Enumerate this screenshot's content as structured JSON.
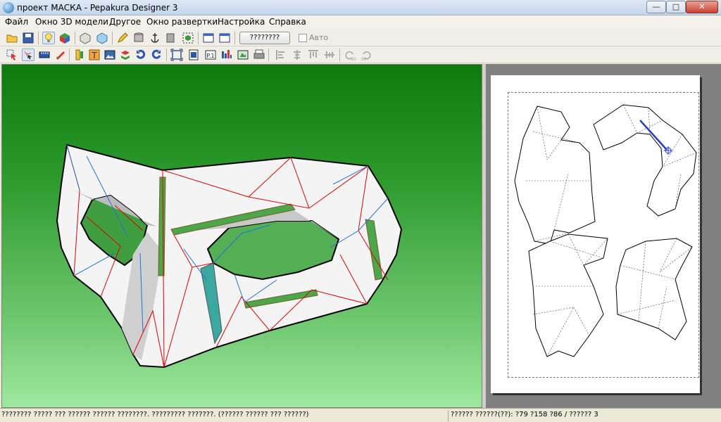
{
  "window": {
    "title": "проект МАСКА - Pepakura Designer 3",
    "min_label": "—",
    "max_label": "□",
    "close_label": "✕"
  },
  "menu": {
    "items": [
      "Файл",
      "Окно 3D модели",
      "Другое",
      "Окно развертки",
      "Настройка",
      "Справка"
    ]
  },
  "toolbar": {
    "unfold_button_label": "????????",
    "auto_label": "Авто",
    "auto_checked": false
  },
  "icons": {
    "toolbar1": [
      "open-folder-icon",
      "save-icon",
      "light-bulb-icon",
      "color-cube-icon",
      "wire-cube-icon",
      "texture-cube-icon",
      "pencil-icon",
      "cylinder-icon",
      "anchor-icon",
      "box-icon",
      "cube-select-icon",
      "single-view-icon",
      "split-view-icon"
    ],
    "toolbar2": [
      "select-arrow-icon",
      "edge-select-icon",
      "edge-ruler-icon",
      "brush-icon",
      "flap-icon",
      "text-icon",
      "image-icon",
      "join-icon",
      "rotate-icon",
      "undo-rotate-icon",
      "fit-frame-icon",
      "page-frame-icon",
      "page-number-icon",
      "parts-icon",
      "fill-icon",
      "print-icon",
      "align-left-icon",
      "align-center-icon",
      "align-top-icon",
      "align-middle-icon",
      "rotate-ccw-90-icon",
      "rotate-cw-90-icon"
    ]
  },
  "colors": {
    "bg_top": "#0c7a0c",
    "bg_bottom": "#9ee89e",
    "mountain_edge": "#e00000",
    "valley_edge": "#1f74d6",
    "flap_fill": "#4aa84a"
  },
  "status": {
    "left_text": "???????? ????? ???  ?????? ?????? ????????. ????????? ???????. (?????? ?????? ??? ??????)",
    "right_text": "?????? ??????(??): ?79 ?158 ?86 / ?????? 3"
  }
}
